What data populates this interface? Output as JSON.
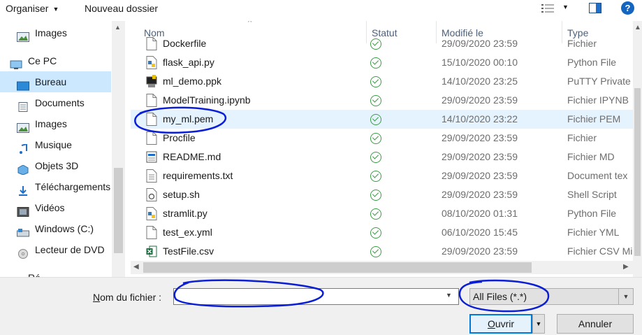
{
  "toolbar": {
    "organiser_label": "Organiser",
    "new_folder_label": "Nouveau dossier",
    "help_label": "?"
  },
  "nav": {
    "items": [
      {
        "label": "Images",
        "icon": "images-icon"
      },
      {
        "label": "Ce PC",
        "icon": "computer-icon"
      },
      {
        "label": "Bureau",
        "icon": "desktop-icon",
        "selected": true
      },
      {
        "label": "Documents",
        "icon": "documents-icon"
      },
      {
        "label": "Images",
        "icon": "images-icon"
      },
      {
        "label": "Musique",
        "icon": "music-icon"
      },
      {
        "label": "Objets 3D",
        "icon": "3d-objects-icon"
      },
      {
        "label": "Téléchargements",
        "icon": "downloads-icon"
      },
      {
        "label": "Vidéos",
        "icon": "videos-icon"
      },
      {
        "label": "Windows (C:)",
        "icon": "drive-icon"
      },
      {
        "label": "Lecteur de DVD",
        "icon": "dvd-icon"
      },
      {
        "label": "Ré",
        "icon": "network-icon"
      }
    ]
  },
  "list": {
    "headers": {
      "name": "Nom",
      "status": "Statut",
      "modified": "Modifié le",
      "type": "Type"
    },
    "rows": [
      {
        "name": "Dockerfile",
        "date": "29/09/2020 23:59",
        "type": "Fichier",
        "icon": "file-icon"
      },
      {
        "name": "flask_api.py",
        "date": "15/10/2020 00:10",
        "type": "Python File",
        "icon": "python-icon"
      },
      {
        "name": "ml_demo.ppk",
        "date": "14/10/2020 23:25",
        "type": "PuTTY Private",
        "icon": "putty-icon"
      },
      {
        "name": "ModelTraining.ipynb",
        "date": "29/09/2020 23:59",
        "type": "Fichier IPYNB",
        "icon": "file-icon"
      },
      {
        "name": "my_ml.pem",
        "date": "14/10/2020 23:22",
        "type": "Fichier PEM",
        "icon": "file-icon",
        "highlighted": true
      },
      {
        "name": "Procfile",
        "date": "29/09/2020 23:59",
        "type": "Fichier",
        "icon": "file-icon"
      },
      {
        "name": "README.md",
        "date": "29/09/2020 23:59",
        "type": "Fichier MD",
        "icon": "markdown-icon"
      },
      {
        "name": "requirements.txt",
        "date": "29/09/2020 23:59",
        "type": "Document tex",
        "icon": "text-file-icon"
      },
      {
        "name": "setup.sh",
        "date": "29/09/2020 23:59",
        "type": "Shell Script",
        "icon": "shell-script-icon"
      },
      {
        "name": "stramlit.py",
        "date": "08/10/2020 01:31",
        "type": "Python File",
        "icon": "python-icon"
      },
      {
        "name": "test_ex.yml",
        "date": "06/10/2020 15:45",
        "type": "Fichier YML",
        "icon": "file-icon"
      },
      {
        "name": "TestFile.csv",
        "date": "29/09/2020 23:59",
        "type": "Fichier CSV Mi",
        "icon": "excel-icon"
      }
    ]
  },
  "bottom": {
    "filename_label": "Nom du fichier :",
    "filename_value": "",
    "filter_value": "All Files (*.*)",
    "open_label": "Ouvrir",
    "cancel_label": "Annuler"
  },
  "colors": {
    "selection": "#cce8ff",
    "hover_row": "#e5f3ff",
    "annotation": "#0a1ed6",
    "status_ok": "#3c9b46",
    "accent": "#0078d7"
  }
}
